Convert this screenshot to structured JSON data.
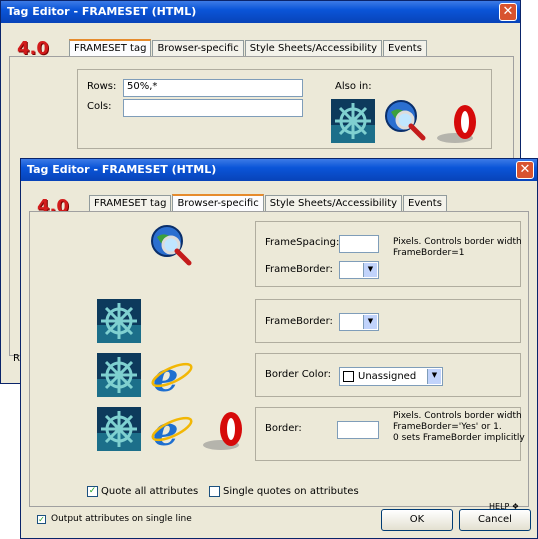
{
  "back": {
    "title": "Tag Editor - FRAMESET   (HTML)",
    "version": "4.0",
    "tabs": [
      "FRAMESET tag",
      "Browser-specific",
      "Style Sheets/Accessibility",
      "Events"
    ],
    "rows_label": "Rows:",
    "rows_value": "50%,*",
    "cols_label": "Cols:",
    "also_in": "Also in:"
  },
  "front": {
    "title": "Tag Editor - FRAMESET   (HTML)",
    "version": "4.0",
    "tabs": [
      "FRAMESET tag",
      "Browser-specific",
      "Style Sheets/Accessibility",
      "Events"
    ],
    "sec1": {
      "framespacing_label": "FrameSpacing:",
      "framespacing_note": "Pixels. Controls border width\nFrameBorder=1",
      "frameborder_label": "FrameBorder:"
    },
    "sec2": {
      "frameborder_label": "FrameBorder:"
    },
    "sec3": {
      "bordercolor_label": "Border Color:",
      "bordercolor_value": "Unassigned"
    },
    "sec4": {
      "border_label": "Border:",
      "border_note": "Pixels. Controls border width\nFrameBorder='Yes' or 1.\n0 sets FrameBorder implicitly"
    },
    "quote_all": "Quote all attributes",
    "single_quotes": "Single quotes on attributes",
    "single_line": "Output attributes on single line",
    "ok": "OK",
    "cancel": "Cancel",
    "help": "HELP"
  },
  "colors": {
    "title": "#0a55d8",
    "version": "#d21c1c",
    "close": "#d8532f"
  }
}
